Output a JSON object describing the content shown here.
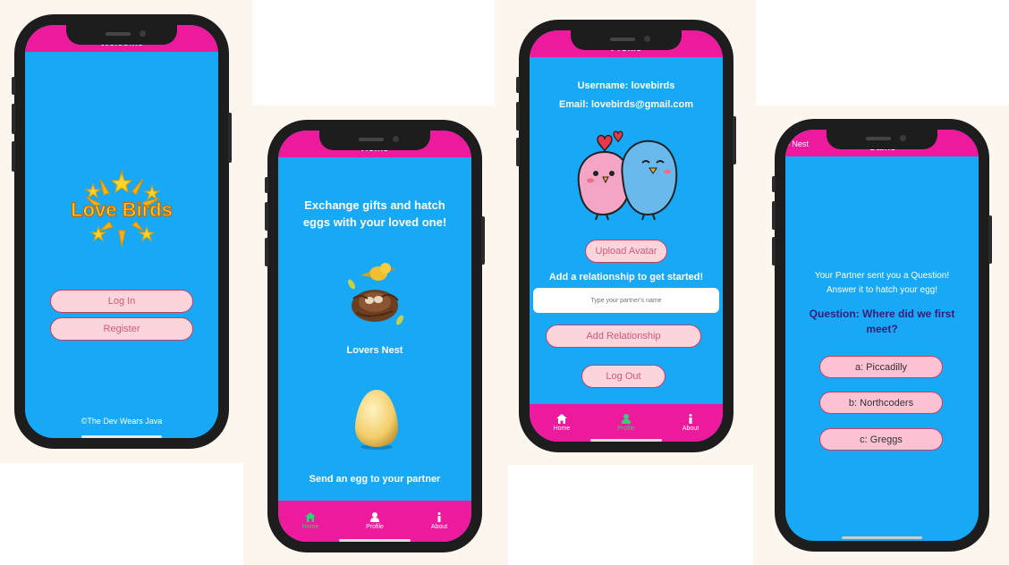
{
  "colors": {
    "screen_bg": "#17a9f5",
    "bar_pink": "#ee1a9e",
    "button_bg": "#fbd5db",
    "button_text": "#d05a7e",
    "question_text": "#3b1a7a",
    "nav_active": "#33d07a"
  },
  "welcome": {
    "title": "Welcome",
    "logo_text": "Love Birds",
    "login_label": "Log In",
    "register_label": "Register",
    "footer": "©The Dev Wears Java"
  },
  "home": {
    "title": "Home",
    "headline": "Exchange gifts and hatch eggs with your loved one!",
    "nest_label": "Lovers Nest",
    "egg_label": "Send an egg to your partner",
    "nav": [
      {
        "label": "Home",
        "icon": "home-icon"
      },
      {
        "label": "Profile",
        "icon": "user-icon"
      },
      {
        "label": "About",
        "icon": "info-icon"
      }
    ]
  },
  "profile": {
    "title": "Profile",
    "username": "Username: lovebirds",
    "email": "Email: lovebirds@gmail.com",
    "upload_label": "Upload Avatar",
    "relationship_prompt": "Add a relationship to get started!",
    "partner_placeholder": "Type your partner's name",
    "add_relationship_label": "Add Relationship",
    "logout_label": "Log Out",
    "nav": [
      {
        "label": "Home",
        "icon": "home-icon"
      },
      {
        "label": "Profile",
        "icon": "user-icon"
      },
      {
        "label": "About",
        "icon": "info-icon"
      }
    ]
  },
  "game": {
    "title": "Game",
    "back_label": "Nest",
    "intro_line1": "Your Partner sent you a Question!",
    "intro_line2": "Answer it to hatch your egg!",
    "question": "Question: Where did we first meet?",
    "answers": [
      "a: Piccadilly",
      "b: Northcoders",
      "c: Greggs"
    ]
  }
}
